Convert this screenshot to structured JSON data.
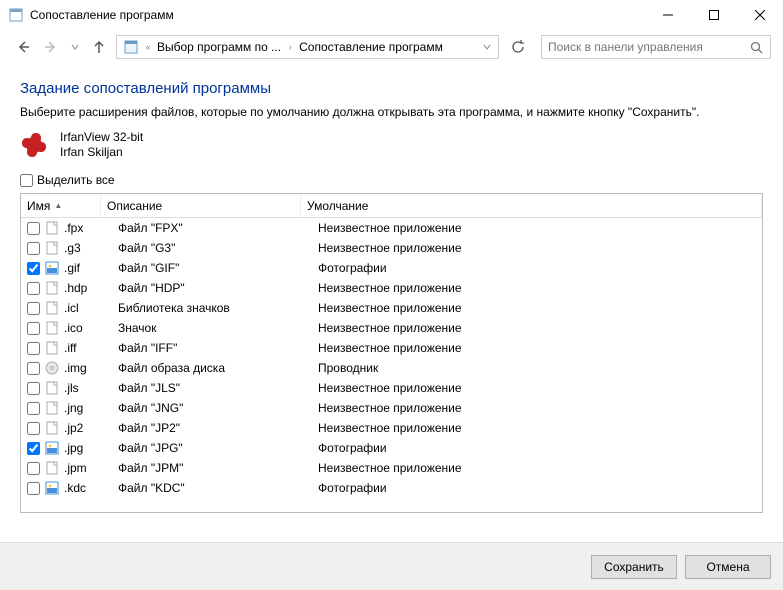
{
  "window": {
    "title": "Сопоставление программ"
  },
  "breadcrumb": {
    "item1": "Выбор программ по ...",
    "item2": "Сопоставление программ"
  },
  "search": {
    "placeholder": "Поиск в панели управления"
  },
  "page": {
    "heading": "Задание сопоставлений программы",
    "instruction": "Выберите расширения файлов, которые по умолчанию должна открывать эта программа, и нажмите кнопку \"Сохранить\".",
    "app_name": "IrfanView 32-bit",
    "app_publisher": "Irfan Skiljan",
    "select_all": "Выделить все"
  },
  "columns": {
    "name": "Имя",
    "desc": "Описание",
    "def": "Умолчание"
  },
  "rows": [
    {
      "checked": false,
      "icon": "generic",
      "ext": ".fpx",
      "desc": "Файл \"FPX\"",
      "def": "Неизвестное приложение"
    },
    {
      "checked": false,
      "icon": "generic",
      "ext": ".g3",
      "desc": "Файл \"G3\"",
      "def": "Неизвестное приложение"
    },
    {
      "checked": true,
      "icon": "photo",
      "ext": ".gif",
      "desc": "Файл \"GIF\"",
      "def": "Фотографии"
    },
    {
      "checked": false,
      "icon": "generic",
      "ext": ".hdp",
      "desc": "Файл \"HDP\"",
      "def": "Неизвестное приложение"
    },
    {
      "checked": false,
      "icon": "generic",
      "ext": ".icl",
      "desc": "Библиотека значков",
      "def": "Неизвестное приложение"
    },
    {
      "checked": false,
      "icon": "generic",
      "ext": ".ico",
      "desc": "Значок",
      "def": "Неизвестное приложение"
    },
    {
      "checked": false,
      "icon": "generic",
      "ext": ".iff",
      "desc": "Файл \"IFF\"",
      "def": "Неизвестное приложение"
    },
    {
      "checked": false,
      "icon": "disc",
      "ext": ".img",
      "desc": "Файл образа диска",
      "def": "Проводник"
    },
    {
      "checked": false,
      "icon": "generic",
      "ext": ".jls",
      "desc": "Файл \"JLS\"",
      "def": "Неизвестное приложение"
    },
    {
      "checked": false,
      "icon": "generic",
      "ext": ".jng",
      "desc": "Файл \"JNG\"",
      "def": "Неизвестное приложение"
    },
    {
      "checked": false,
      "icon": "generic",
      "ext": ".jp2",
      "desc": "Файл \"JP2\"",
      "def": "Неизвестное приложение"
    },
    {
      "checked": true,
      "icon": "photo",
      "ext": ".jpg",
      "desc": "Файл \"JPG\"",
      "def": "Фотографии"
    },
    {
      "checked": false,
      "icon": "generic",
      "ext": ".jpm",
      "desc": "Файл \"JPM\"",
      "def": "Неизвестное приложение"
    },
    {
      "checked": false,
      "icon": "photo",
      "ext": ".kdc",
      "desc": "Файл \"KDC\"",
      "def": "Фотографии"
    }
  ],
  "buttons": {
    "save": "Сохранить",
    "cancel": "Отмена"
  }
}
